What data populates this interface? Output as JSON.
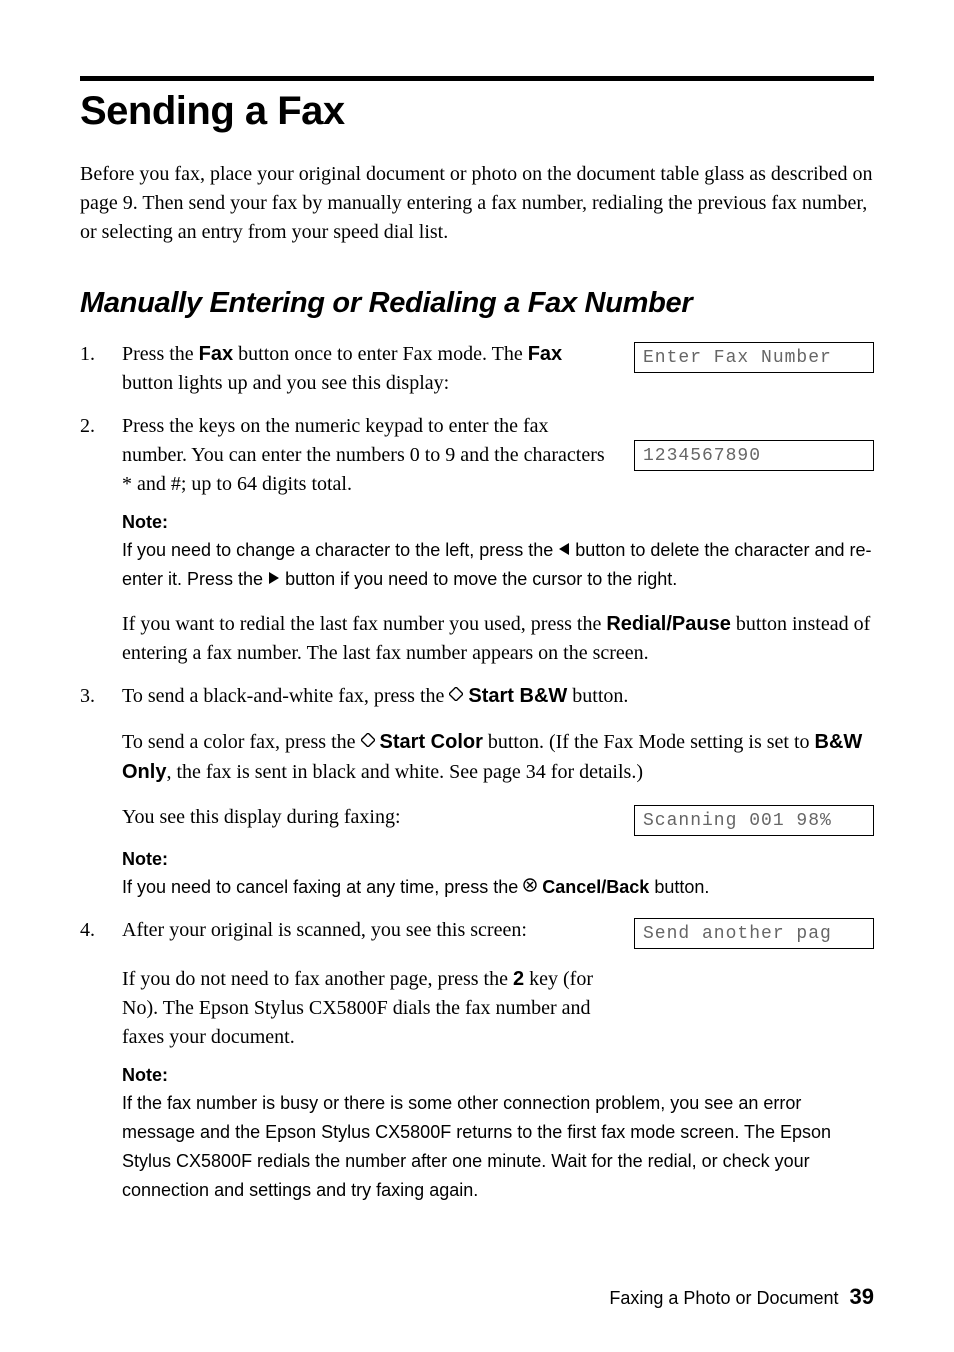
{
  "heading1": "Sending a Fax",
  "intro": "Before you fax, place your original document or photo on the document table glass as described on page 9. Then send your fax by manually entering a fax number, redialing the previous fax number, or selecting an entry from your speed dial list.",
  "heading2": "Manually Entering or Redialing a Fax Number",
  "steps": {
    "s1": {
      "p1a": "Press the ",
      "fax": "Fax",
      "p1b": " button once to enter Fax mode. The ",
      "p1c": " button lights up and you see this display:",
      "lcd": "Enter Fax Number"
    },
    "s2": {
      "p1": "Press the keys on the numeric keypad to enter the fax number. You can enter the numbers 0 to 9 and the characters * and #; up to 64 digits total.",
      "lcd": "1234567890",
      "noteLabel": "Note:",
      "note_a": "If you need to change a character to the left, press the ",
      "note_b": " button to delete the character and re-enter it. Press the ",
      "note_c": " button if you need to move the cursor to the right.",
      "redial_a": "If you want to redial the last fax number you used, press the ",
      "redial_btn": "Redial/Pause",
      "redial_b": " button instead of entering a fax number. The last fax number appears on the screen."
    },
    "s3": {
      "p1a": "To send a black-and-white fax, press the ",
      "startbw": "Start B&W",
      "p1b": " button.",
      "p2a": "To send a color fax, press the ",
      "startcolor": "Start Color",
      "p2b": " button. (If the Fax Mode setting is set to ",
      "bwonly": "B&W Only",
      "p2c": ", the fax is sent in black and white. See page 34 for details.)",
      "p3": "You see this display during faxing:",
      "lcd": "Scanning 001 98%",
      "noteLabel": "Note:",
      "note_a": "If you need to cancel faxing at any time, press the ",
      "cancel_btn": "Cancel/Back",
      "note_b": " button."
    },
    "s4": {
      "p1": "After your original is scanned, you see this screen:",
      "lcd": "Send another pag",
      "p2a": "If you do not need to fax another page, press the ",
      "key2": "2",
      "p2b": " key (for No). The Epson Stylus CX5800F dials the fax number and faxes your document.",
      "noteLabel": "Note:",
      "note": "If the fax number is busy or there is some other connection problem, you see an error message and the Epson Stylus CX5800F returns to the first fax mode screen. The Epson Stylus CX5800F redials the number after one minute. Wait for the redial, or check your connection and settings and try faxing again."
    }
  },
  "footer": {
    "title": "Faxing a Photo or Document",
    "page": "39"
  }
}
